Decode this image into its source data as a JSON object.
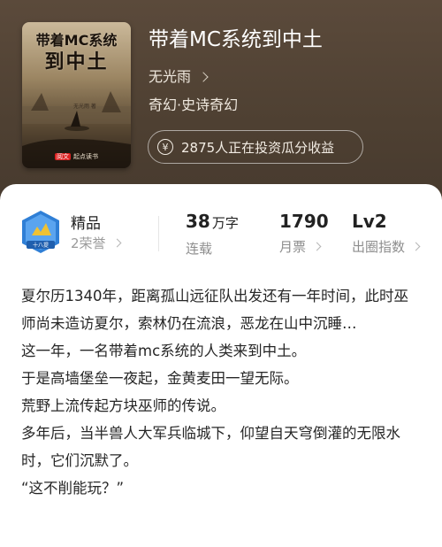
{
  "cover": {
    "title_line1": "带着MC系统",
    "title_line2": "到中土",
    "author": "无光雨 著",
    "brand_tag": "阅文",
    "brand": "起点读书"
  },
  "book": {
    "title": "带着MC系统到中土",
    "author": "无光雨",
    "genre": "奇幻·史诗奇幻",
    "invest_text": "2875人正在投资瓜分收益",
    "yen_symbol": "¥"
  },
  "honor": {
    "badge_text": "十八提",
    "title": "精品",
    "count_label": "2荣誉"
  },
  "stats": [
    {
      "value": "38",
      "unit": "万字",
      "label": "连载",
      "has_chevron": false
    },
    {
      "value": "1790",
      "unit": "",
      "label": "月票",
      "has_chevron": true
    },
    {
      "value": "Lv2",
      "unit": "",
      "label": "出圈指数",
      "has_chevron": true
    }
  ],
  "description": [
    "夏尔历1340年，距离孤山远征队出发还有一年时间，此时巫师尚未造访夏尔，索林仍在流浪，恶龙在山中沉睡…",
    "这一年，一名带着mc系统的人类来到中土。",
    "于是高墙堡垒一夜起，金黄麦田一望无际。",
    "荒野上流传起方块巫师的传说。",
    "多年后，当半兽人大军兵临城下，仰望自天穹倒灌的无限水时，它们沉默了。",
    "“这不削能玩？”"
  ],
  "colors": {
    "hero_bg": "#4e4032",
    "badge_blue": "#2f7fd6",
    "badge_gold": "#f0c233"
  }
}
